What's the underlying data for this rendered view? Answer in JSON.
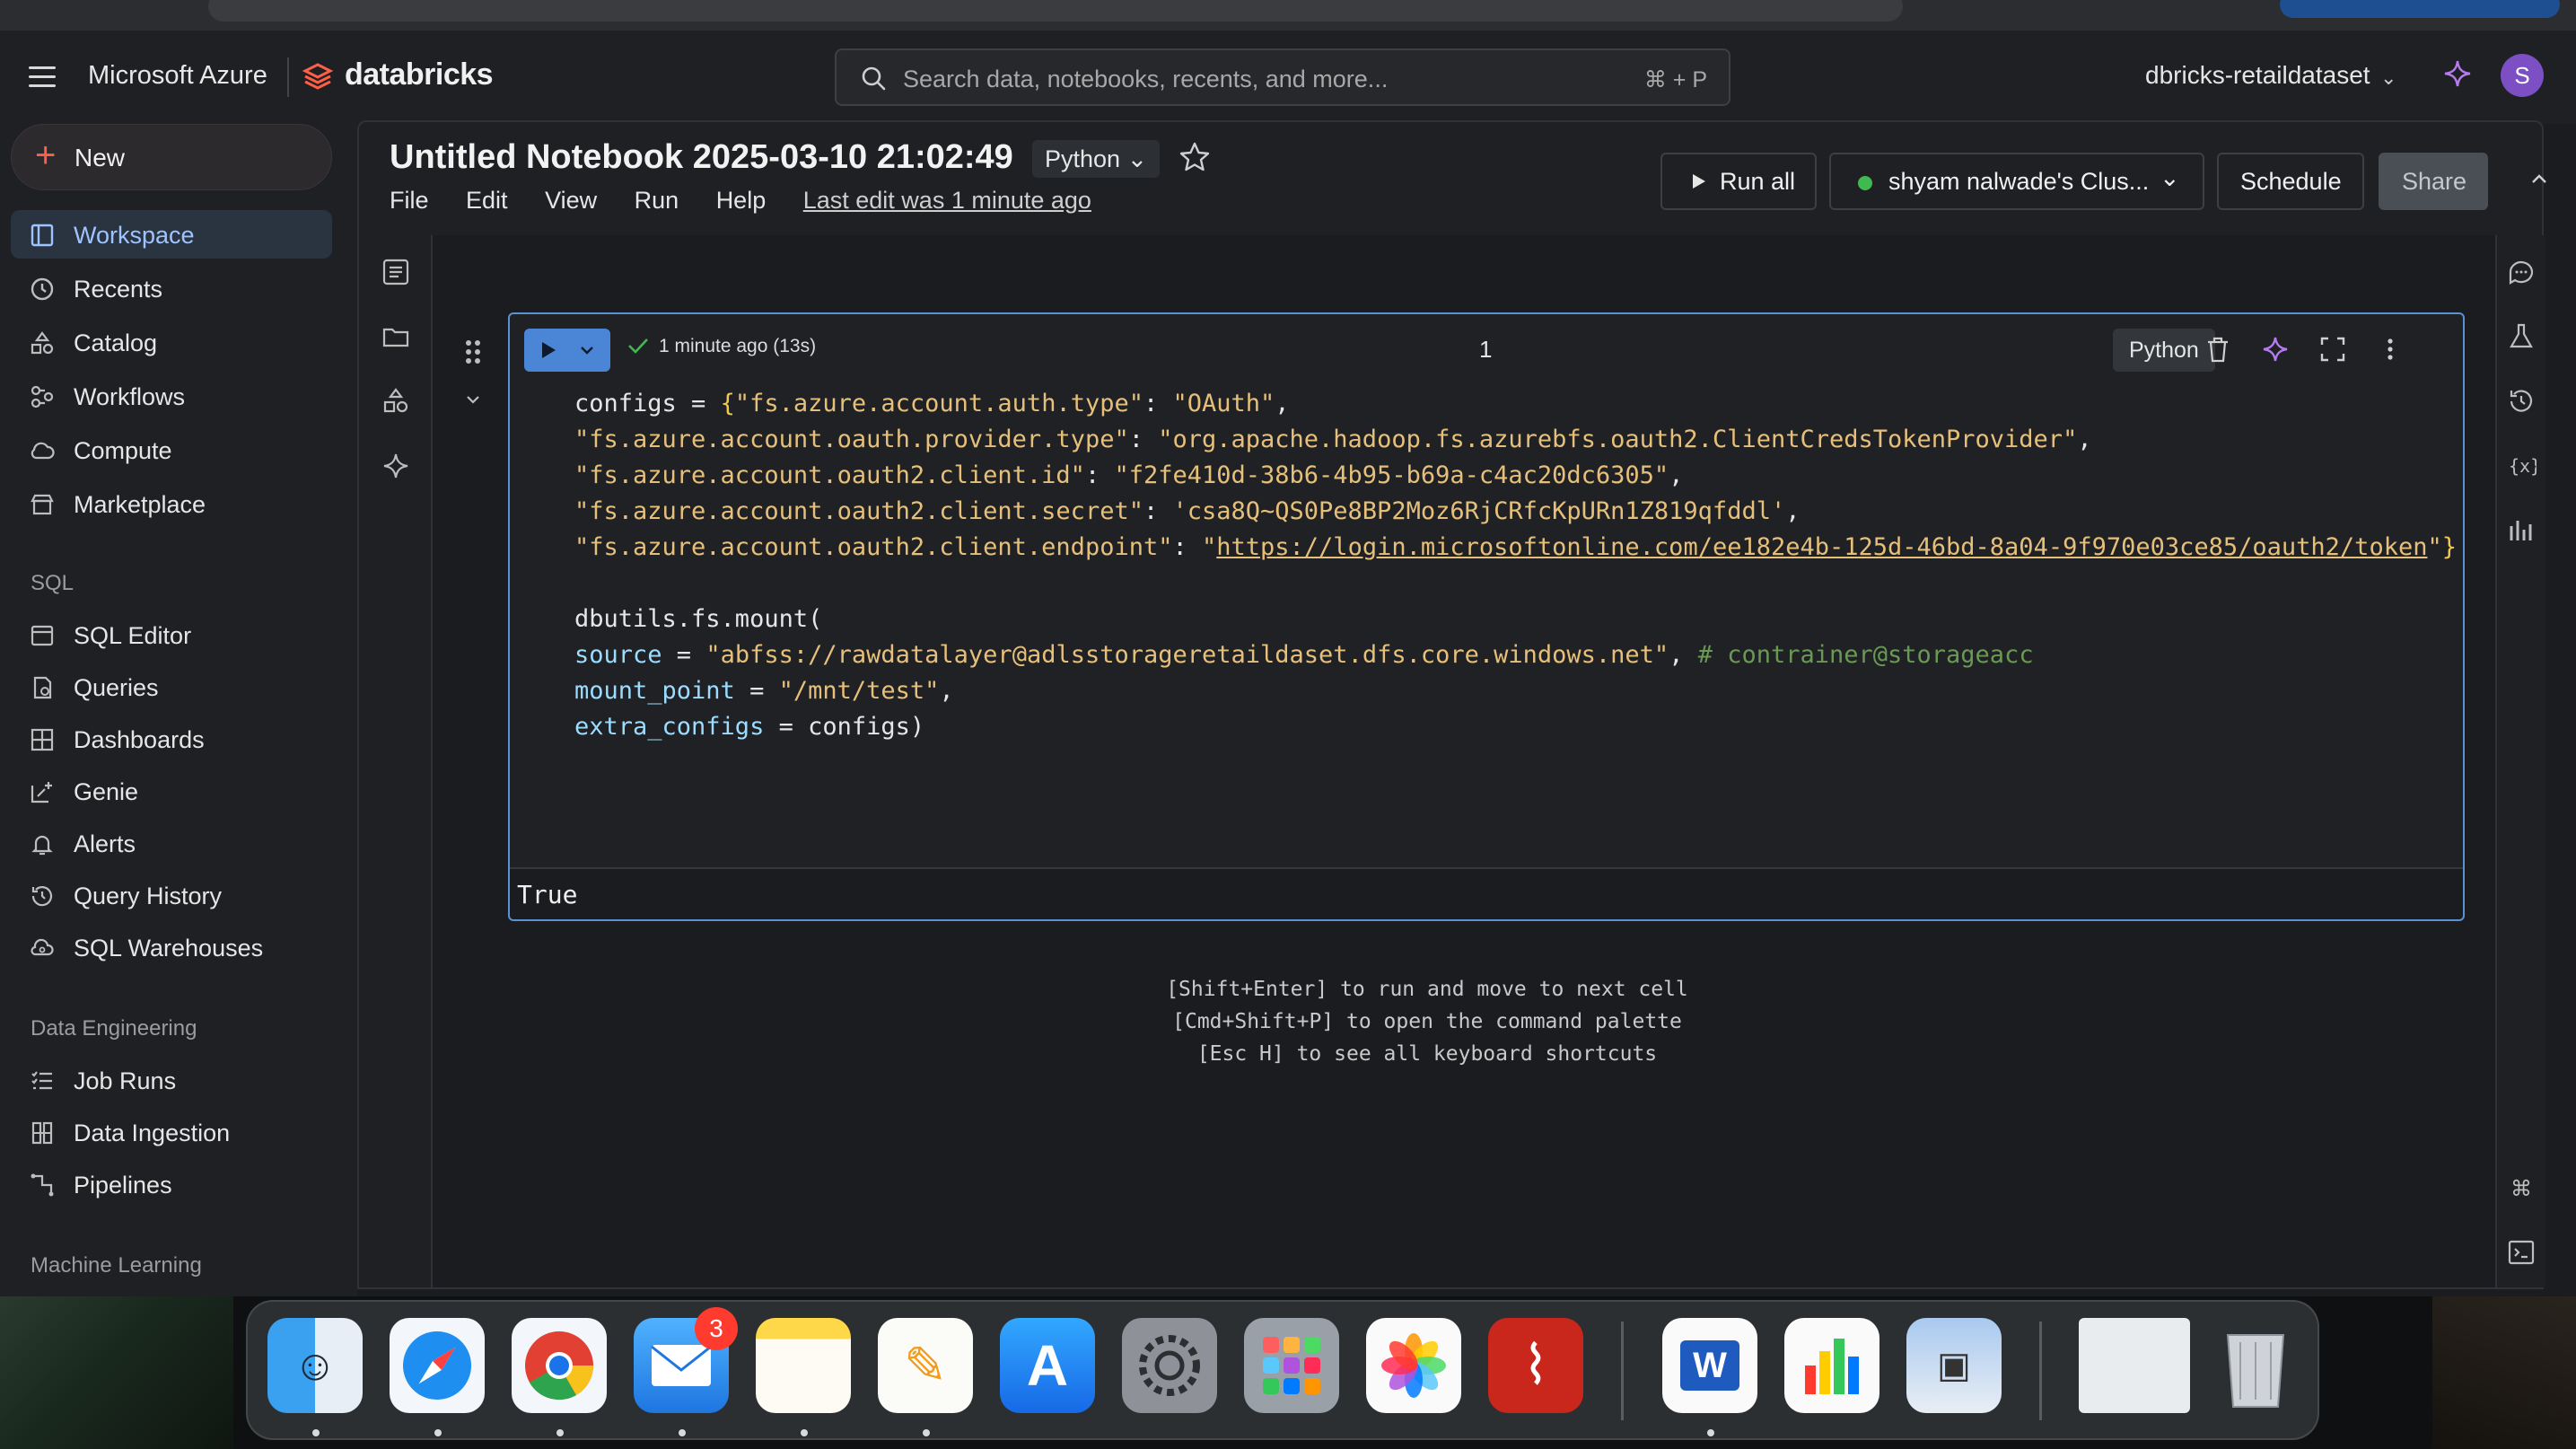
{
  "app": {
    "brand_vendor": "Microsoft Azure",
    "brand_name": "databricks",
    "accent": "#ff5f46"
  },
  "search": {
    "placeholder": "Search data, notebooks, recents, and more...",
    "shortcut": "⌘ + P"
  },
  "workspace": {
    "name": "dbricks-retaildataset",
    "avatar_initial": "S"
  },
  "sidebar": {
    "new_label": "New",
    "items": [
      {
        "label": "Workspace",
        "icon": "workspace-icon",
        "active": true
      },
      {
        "label": "Recents",
        "icon": "clock-icon"
      },
      {
        "label": "Catalog",
        "icon": "catalog-icon"
      },
      {
        "label": "Workflows",
        "icon": "workflows-icon"
      },
      {
        "label": "Compute",
        "icon": "cloud-icon"
      },
      {
        "label": "Marketplace",
        "icon": "store-icon"
      }
    ],
    "sql_header": "SQL",
    "sql_items": [
      {
        "label": "SQL Editor",
        "icon": "editor-icon"
      },
      {
        "label": "Queries",
        "icon": "queries-icon"
      },
      {
        "label": "Dashboards",
        "icon": "dashboard-icon"
      },
      {
        "label": "Genie",
        "icon": "genie-icon"
      },
      {
        "label": "Alerts",
        "icon": "bell-icon"
      },
      {
        "label": "Query History",
        "icon": "history-icon"
      },
      {
        "label": "SQL Warehouses",
        "icon": "warehouse-icon"
      }
    ],
    "de_header": "Data Engineering",
    "de_items": [
      {
        "label": "Job Runs",
        "icon": "job-runs-icon"
      },
      {
        "label": "Data Ingestion",
        "icon": "ingestion-icon"
      },
      {
        "label": "Pipelines",
        "icon": "pipelines-icon"
      }
    ],
    "ml_header": "Machine Learning"
  },
  "notebook": {
    "title": "Untitled Notebook 2025-03-10 21:02:49",
    "language": "Python",
    "menus": [
      "File",
      "Edit",
      "View",
      "Run",
      "Help"
    ],
    "last_edit": "Last edit was 1 minute ago",
    "run_all_label": "Run all",
    "cluster_label": "shyam nalwade's Clus...",
    "cluster_status_color": "#3fb950",
    "schedule_label": "Schedule",
    "share_label": "Share"
  },
  "cell": {
    "number": "1",
    "status": "1 minute ago (13s)",
    "language": "Python",
    "code_lines": [
      [
        [
          "configs = ",
          ""
        ],
        [
          "{",
          "br"
        ],
        [
          "\"fs.azure.account.auth.type\"",
          "str"
        ],
        [
          ": ",
          ""
        ],
        [
          "\"OAuth\"",
          "str"
        ],
        [
          ",",
          ""
        ]
      ],
      [
        [
          "\"fs.azure.account.oauth.provider.type\"",
          "str"
        ],
        [
          ": ",
          ""
        ],
        [
          "\"org.apache.hadoop.fs.azurebfs.oauth2.ClientCredsTokenProvider\"",
          "str"
        ],
        [
          ",",
          ""
        ]
      ],
      [
        [
          "\"fs.azure.account.oauth2.client.id\"",
          "str"
        ],
        [
          ": ",
          ""
        ],
        [
          "\"f2fe410d-38b6-4b95-b69a-c4ac20dc6305\"",
          "str"
        ],
        [
          ",",
          ""
        ]
      ],
      [
        [
          "\"fs.azure.account.oauth2.client.secret\"",
          "str"
        ],
        [
          ": ",
          ""
        ],
        [
          "'csa8Q~QS0Pe8BP2Moz6RjCRfcKpURn1Z819qfddl'",
          "str"
        ],
        [
          ",",
          ""
        ]
      ],
      [
        [
          "\"fs.azure.account.oauth2.client.endpoint\"",
          "str"
        ],
        [
          ": ",
          ""
        ],
        [
          "\"",
          "str"
        ],
        [
          "https://login.microsoftonline.com/ee182e4b-125d-46bd-8a04-9f970e03ce85/oauth2/token",
          "url"
        ],
        [
          "\"",
          "str"
        ],
        [
          "}",
          "br"
        ]
      ],
      [
        [
          "",
          ""
        ]
      ],
      [
        [
          "dbutils.fs.mount(",
          ""
        ]
      ],
      [
        [
          "source",
          "kw"
        ],
        [
          " = ",
          ""
        ],
        [
          "\"abfss://rawdatalayer@adlsstorageretaildaset.dfs.core.windows.net\"",
          "str"
        ],
        [
          ", ",
          ""
        ],
        [
          "# contrainer@storageacc",
          "cm"
        ]
      ],
      [
        [
          "mount_point",
          "kw"
        ],
        [
          " = ",
          ""
        ],
        [
          "\"/mnt/test\"",
          "str"
        ],
        [
          ",",
          ""
        ]
      ],
      [
        [
          "extra_configs",
          "kw"
        ],
        [
          " = ",
          ""
        ],
        [
          "configs)",
          ""
        ]
      ]
    ],
    "output": "True"
  },
  "hints": [
    "[Shift+Enter] to run and move to next cell",
    "[Cmd+Shift+P] to open the command palette",
    "[Esc H] to see all keyboard shortcuts"
  ],
  "dock": {
    "mail_badge": "3",
    "apps": [
      "finder-icon",
      "safari-icon",
      "chrome-icon",
      "mail-icon",
      "notes-icon",
      "pages-icon",
      "app-store-icon",
      "system-settings-icon",
      "launchpad-icon",
      "photos-icon",
      "acrobat-icon",
      "word-icon",
      "numbers-icon",
      "preview-icon",
      "screenshot-thumbnail",
      "trash-icon"
    ]
  }
}
